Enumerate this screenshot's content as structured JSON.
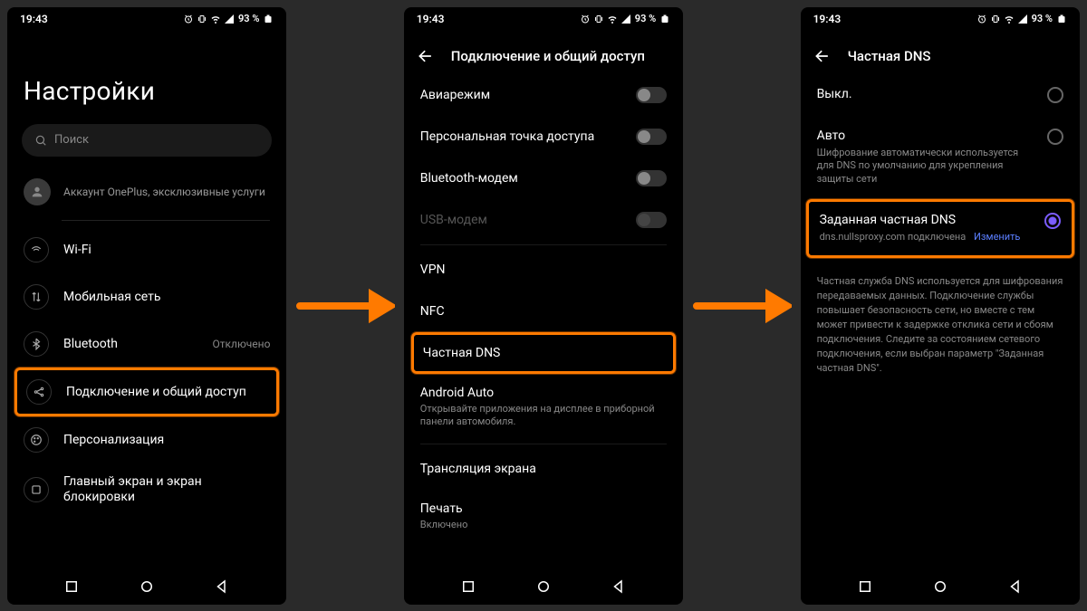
{
  "statusbar": {
    "time": "19:43",
    "battery": "93 %"
  },
  "screen1": {
    "title": "Настройки",
    "search_placeholder": "Поиск",
    "account_text": "Аккаунт OnePlus, эксклюзивные услуги",
    "items": [
      {
        "label": "Wi-Fi"
      },
      {
        "label": "Мобильная сеть"
      },
      {
        "label": "Bluetooth",
        "trail": "Отключено"
      },
      {
        "label": "Подключение и общий доступ",
        "highlight": true
      },
      {
        "label": "Персонализация"
      },
      {
        "label": "Главный экран и экран блокировки"
      }
    ]
  },
  "screen2": {
    "header": "Подключение и общий доступ",
    "rows": [
      {
        "label": "Авиарежим",
        "toggle": true
      },
      {
        "label": "Персональная точка доступа",
        "toggle": true
      },
      {
        "label": "Bluetooth-модем",
        "toggle": true
      },
      {
        "label": "USB-модем",
        "toggle": true,
        "dim": true
      },
      {
        "sep": true
      },
      {
        "label": "VPN"
      },
      {
        "label": "NFC"
      },
      {
        "label": "Частная DNS",
        "highlight": true
      },
      {
        "label": "Android Auto",
        "sub": "Открывайте приложения на дисплее в приборной панели автомобиля."
      },
      {
        "sep": true
      },
      {
        "label": "Трансляция экрана"
      },
      {
        "label": "Печать",
        "sub": "Включено"
      }
    ]
  },
  "screen3": {
    "header": "Частная DNS",
    "options": [
      {
        "title": "Выкл."
      },
      {
        "title": "Авто",
        "sub": "Шифрование автоматически используется для DNS по умолчанию для укрепления защиты сети"
      },
      {
        "title": "Заданная частная DNS",
        "sub": "dns.nullsproxy.com подключена",
        "link": "Изменить",
        "selected": true,
        "highlight": true
      }
    ],
    "info": "Частная служба DNS используется для шифрования передаваемых данных. Подключение службы повышает безопасность сети, но вместе с тем может привести к задержке отклика сети и сбоям подключения. Следите за состоянием сетевого подключения, если выбран параметр \"Заданная частная DNS\"."
  }
}
